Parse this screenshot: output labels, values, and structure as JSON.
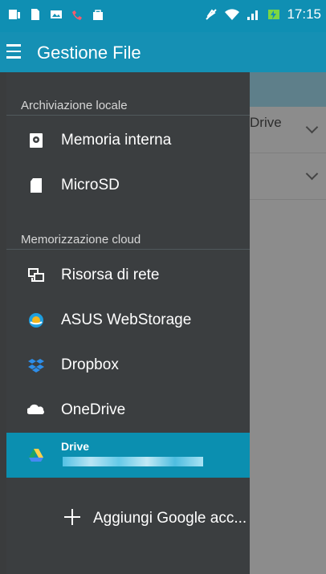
{
  "status_bar": {
    "time": "17:15"
  },
  "app_bar": {
    "title": "Gestione File"
  },
  "background": {
    "items": [
      {
        "label": "Drive"
      },
      {
        "label": ""
      }
    ]
  },
  "drawer": {
    "local_section": {
      "label": "Archiviazione locale",
      "items": [
        {
          "label": "Memoria interna",
          "icon": "phone-storage-icon"
        },
        {
          "label": "MicroSD",
          "icon": "sd-card-icon"
        }
      ]
    },
    "cloud_section": {
      "label": "Memorizzazione cloud",
      "items": [
        {
          "label": "Risorsa di rete",
          "icon": "network-share-icon"
        },
        {
          "label": "ASUS WebStorage",
          "icon": "asus-webstorage-icon"
        },
        {
          "label": "Dropbox",
          "icon": "dropbox-icon"
        },
        {
          "label": "OneDrive",
          "icon": "onedrive-icon"
        },
        {
          "label": "Drive",
          "icon": "google-drive-icon"
        }
      ]
    },
    "add_account": {
      "label": "Aggiungi Google acc..."
    }
  },
  "colors": {
    "accent": "#1590b4",
    "drawer_bg": "#3b3e40",
    "active_row": "#0b8fb0"
  }
}
